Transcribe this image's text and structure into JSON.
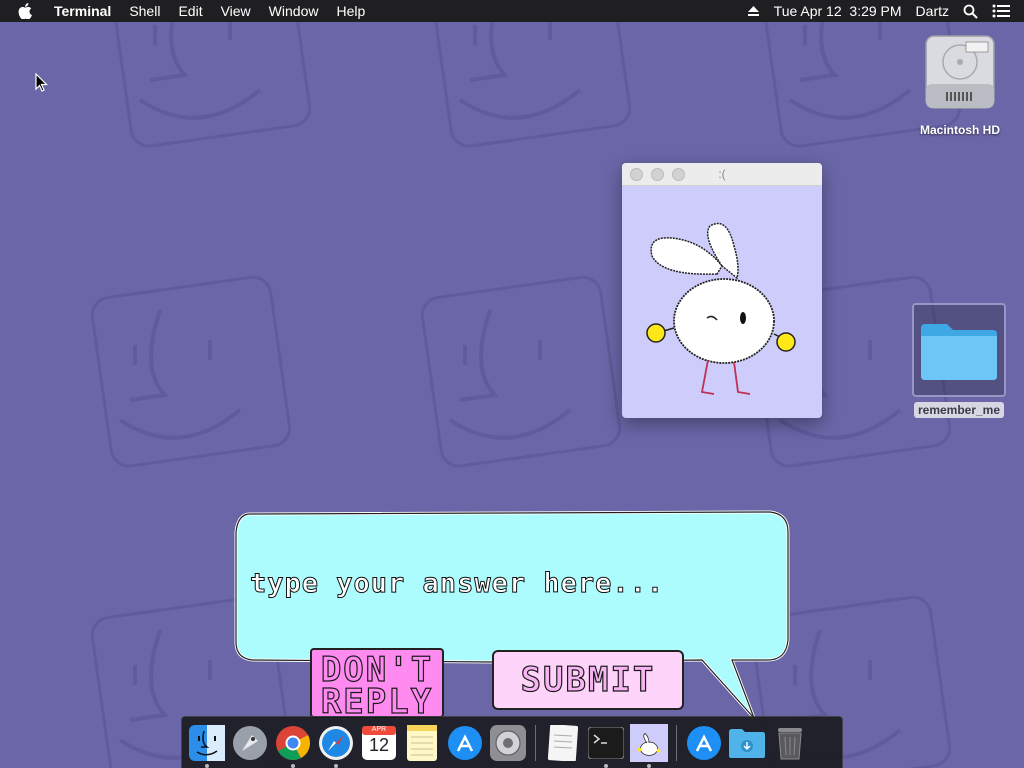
{
  "menubar": {
    "app_name": "Terminal",
    "menus": [
      "Shell",
      "Edit",
      "View",
      "Window",
      "Help"
    ],
    "datetime": "Tue Apr 12  3:29 PM",
    "user": "Dartz"
  },
  "desktop": {
    "hd_label": "Macintosh HD",
    "folder_label": "remember_me"
  },
  "window": {
    "title": ":("
  },
  "bubble": {
    "placeholder": "type your answer here...",
    "dont_reply_label": "DON'T REPLY",
    "submit_label": "SUBMIT"
  },
  "dock": {
    "calendar_month": "APR",
    "calendar_day": "12",
    "items": [
      "finder-icon",
      "launchpad-icon",
      "chrome-icon",
      "safari-icon",
      "calendar-icon",
      "notes-icon",
      "app-store-icon",
      "system-preferences-icon",
      "textedit-icon",
      "terminal-icon",
      "bunny-app-icon",
      "app-store-downloads-icon",
      "downloads-folder-icon",
      "trash-icon"
    ]
  },
  "colors": {
    "wallpaper": "#6a66a8",
    "bubble": "#adfcfd",
    "dont_reply": "#ff8bf0",
    "submit": "#ffd4fa",
    "window_bg": "#ceccfb"
  }
}
